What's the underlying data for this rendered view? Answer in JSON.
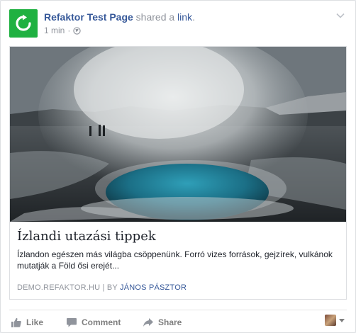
{
  "post": {
    "page_name": "Refaktor Test Page",
    "action_text": " shared a ",
    "action_link": "link",
    "action_end": ".",
    "time": "1 min",
    "dot": "·"
  },
  "card": {
    "title": "Ízlandi utazási tippek",
    "description": "Ízlandon egészen más világba csöppenünk. Forró vizes források, gejzírek, vulkánok mutatják a Föld ősi erejét...",
    "domain": "DEMO.REFAKTOR.HU",
    "separator": " | ",
    "by": "BY ",
    "author": "JÁNOS PÁSZTOR"
  },
  "actions": {
    "like": "Like",
    "comment": "Comment",
    "share": "Share"
  },
  "icons": {
    "avatar": "refresh-arrow-icon",
    "globe": "globe-icon",
    "chevron": "chevron-down-icon",
    "like": "thumbs-up-icon",
    "comment": "speech-bubble-icon",
    "share": "share-arrow-icon"
  },
  "colors": {
    "brand_green": "#1fb141",
    "link_blue": "#365899",
    "muted": "#90949c"
  }
}
